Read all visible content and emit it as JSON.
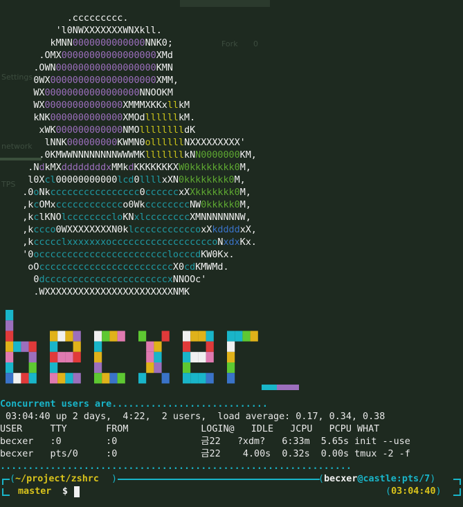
{
  "ghost": {
    "fork": "Fork",
    "fork_count": "0",
    "settings": "Settings",
    "tps": "TPS",
    "network": "network"
  },
  "ascii_art": [
    [
      [
        "w",
        "            .ccccccccc.            "
      ]
    ],
    [
      [
        "w",
        "          'l0NWXXXXXXXWNXkll.        "
      ]
    ],
    [
      [
        "w",
        "         kMNN"
      ],
      [
        "p",
        "0000000000000"
      ],
      [
        "w",
        "NNK0;      "
      ]
    ],
    [
      [
        "w",
        "       .OMX"
      ],
      [
        "p",
        "00000000000000000"
      ],
      [
        "w",
        "XMd     "
      ]
    ],
    [
      [
        "w",
        "      .OWN"
      ],
      [
        "p",
        "000000000000000000"
      ],
      [
        "w",
        "KMN     "
      ]
    ],
    [
      [
        "w",
        "      0WX"
      ],
      [
        "p",
        "0000000000000000000"
      ],
      [
        "w",
        "XMM,    "
      ]
    ],
    [
      [
        "w",
        "      WX"
      ],
      [
        "p",
        "00000000000000000"
      ],
      [
        "w",
        "NNOOKM     "
      ]
    ],
    [
      [
        "w",
        "      WX"
      ],
      [
        "p",
        "00000000000000"
      ],
      [
        "w",
        "XMMMXKKx"
      ],
      [
        "y",
        "ll"
      ],
      [
        "w",
        "kM     "
      ]
    ],
    [
      [
        "w",
        "      kNK"
      ],
      [
        "p",
        "0000000000000"
      ],
      [
        "w",
        "XMOd"
      ],
      [
        "y",
        "llllll"
      ],
      [
        "w",
        "kM.    "
      ]
    ],
    [
      [
        "w",
        "       xWK"
      ],
      [
        "p",
        "000000000000"
      ],
      [
        "w",
        "NMO"
      ],
      [
        "y",
        "llllllll"
      ],
      [
        "w",
        "dK    "
      ]
    ],
    [
      [
        "w",
        "        lNNK"
      ],
      [
        "p",
        "000000000"
      ],
      [
        "w",
        "KWMN0"
      ],
      [
        "y",
        "ollllll"
      ],
      [
        "w",
        "NXXXXXXXXX'"
      ]
    ],
    [
      [
        "w",
        "       .0KMWWNNNNNNNNWWWMK"
      ],
      [
        "y",
        "lllllll"
      ],
      [
        "w",
        "kN"
      ],
      [
        "g",
        "N0000000"
      ],
      [
        "w",
        "KM,"
      ]
    ],
    [
      [
        "w",
        "     .N"
      ],
      [
        "p",
        "d"
      ],
      [
        "w",
        "kMX"
      ],
      [
        "p",
        "ddddddddx"
      ],
      [
        "w",
        "MMk"
      ],
      [
        "p",
        "d"
      ],
      [
        "w",
        "KKKKKKKX"
      ],
      [
        "g",
        "W0kkkkkkkk0"
      ],
      [
        "w",
        "M,"
      ]
    ],
    [
      [
        "w",
        "     l0X"
      ],
      [
        "t",
        "cl"
      ],
      [
        "w",
        "00000000000"
      ],
      [
        "t",
        "lcd"
      ],
      [
        "w",
        "0"
      ],
      [
        "t",
        "llll"
      ],
      [
        "w",
        "xXN"
      ],
      [
        "g",
        "0kkkkkkkk0"
      ],
      [
        "w",
        "M,"
      ]
    ],
    [
      [
        "w",
        "    .0"
      ],
      [
        "t",
        "o"
      ],
      [
        "w",
        "Nk"
      ],
      [
        "t",
        "cccccccccccccccc"
      ],
      [
        "w",
        "0"
      ],
      [
        "t",
        "cccccc"
      ],
      [
        "w",
        "xX"
      ],
      [
        "g",
        "Xkkkkkkk0"
      ],
      [
        "w",
        "M,"
      ]
    ],
    [
      [
        "w",
        "    ,k"
      ],
      [
        "t",
        "c"
      ],
      [
        "w",
        "OMx"
      ],
      [
        "t",
        "cccccccccccc"
      ],
      [
        "w",
        "o0Wk"
      ],
      [
        "t",
        "cccccccc"
      ],
      [
        "w",
        "NW"
      ],
      [
        "g",
        "0kkkkk0"
      ],
      [
        "w",
        "M,"
      ]
    ],
    [
      [
        "w",
        "    ,k"
      ],
      [
        "t",
        "c"
      ],
      [
        "w",
        "lKNO"
      ],
      [
        "t",
        "lcccccccclo"
      ],
      [
        "w",
        "KN"
      ],
      [
        "t",
        "xlcccccccc"
      ],
      [
        "w",
        "XMNNNNNNNW,"
      ]
    ],
    [
      [
        "w",
        "    ,k"
      ],
      [
        "t",
        "ccco"
      ],
      [
        "w",
        "0WXXXXXXXXN0k"
      ],
      [
        "t",
        "lccccccccccco"
      ],
      [
        "w",
        "xX"
      ],
      [
        "b",
        "kdddd"
      ],
      [
        "w",
        "xX,"
      ]
    ],
    [
      [
        "w",
        "    ,k"
      ],
      [
        "t",
        "ccccclxxxxxxxocccccccccccccccccco"
      ],
      [
        "w",
        "N"
      ],
      [
        "b",
        "xdx"
      ],
      [
        "w",
        "Kx."
      ]
    ],
    [
      [
        "w",
        "    '0"
      ],
      [
        "t",
        "occccccccccccccccccccccclocccd"
      ],
      [
        "w",
        "KW0Kx."
      ]
    ],
    [
      [
        "w",
        "     oO"
      ],
      [
        "t",
        "cccccccccccccccccccccccc"
      ],
      [
        "w",
        "X0"
      ],
      [
        "t",
        "cd"
      ],
      [
        "w",
        "KMWMd."
      ]
    ],
    [
      [
        "w",
        "      0"
      ],
      [
        "t",
        "dccccccccccccccccccccccx"
      ],
      [
        "w",
        "NNOOc'"
      ]
    ],
    [
      [
        "w",
        "      .WXXXXXXXXXXXXXXXXXXXXXXXNMK"
      ]
    ]
  ],
  "banner": {
    "text": "becxer"
  },
  "terminal": {
    "concurrent_label": "Concurrent users are",
    "concurrent_dots": "............................",
    "uptime_line": " 03:04:40 up 2 days,  4:22,  2 users,  load average: 0.17, 0.34, 0.38",
    "who_header": "USER     TTY       FROM             LOGIN@   IDLE   JCPU   PCPU WHAT",
    "who_rows": [
      "becxer   :0        :0               금22   ?xdm?   6:33m  5.65s init --use",
      "becxer   pts/0     :0               금22    4.00s  0.32s  0.00s tmux -2 -f"
    ],
    "separator_dots": "...............................................................",
    "prompt": {
      "path": "~/project/zshrc",
      "user": "becxer",
      "at": "@",
      "host": "castle",
      "tty": ":pts/7",
      "branch": "master",
      "symbol": "$",
      "time": "03:04:40"
    }
  },
  "colors": {
    "background": "#1e2a20",
    "cyan": "#19b5c9",
    "yellow": "#d9c31b",
    "purple": "#9c6fbd",
    "olive": "#c9c21a",
    "green": "#5ea832",
    "teal": "#1f9aa4",
    "blue": "#3a73c8"
  }
}
